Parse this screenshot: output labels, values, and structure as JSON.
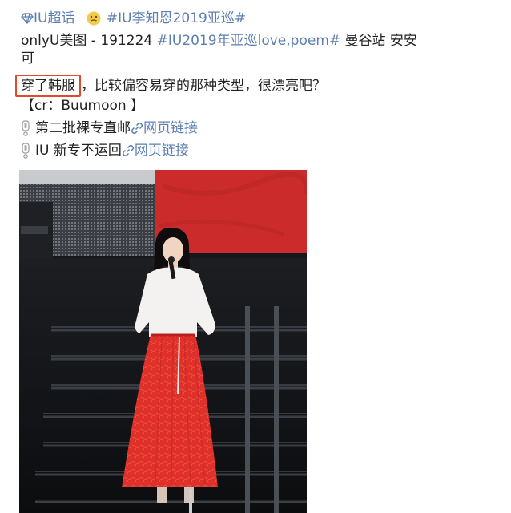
{
  "post": {
    "supertopic_label": "IU超话",
    "hashtag_tour": "#IU李知恩2019亚巡#",
    "author_text": "onlyU美图 - 191224",
    "hashtag_love_poem": "#IU2019年亚巡love,poem#",
    "location_text": "曼谷站 安安",
    "location_cont": "可",
    "highlight_phrase": "穿了韩服",
    "body_rest": "，比较偏容易穿的那种类型，很漂亮吧？",
    "credit": "【cr：Buumoon 】",
    "note1_text": "第二批裸专直邮",
    "note2_text": "IU 新专不运回",
    "link_label": "网页链接"
  },
  "colors": {
    "link_blue": "#5b7fb3",
    "highlight_border": "#e24a2c",
    "skirt_red": "#e0302a"
  },
  "icons": [
    "diamond-icon",
    "emoji-icon",
    "exclamation-icon",
    "link-icon"
  ]
}
